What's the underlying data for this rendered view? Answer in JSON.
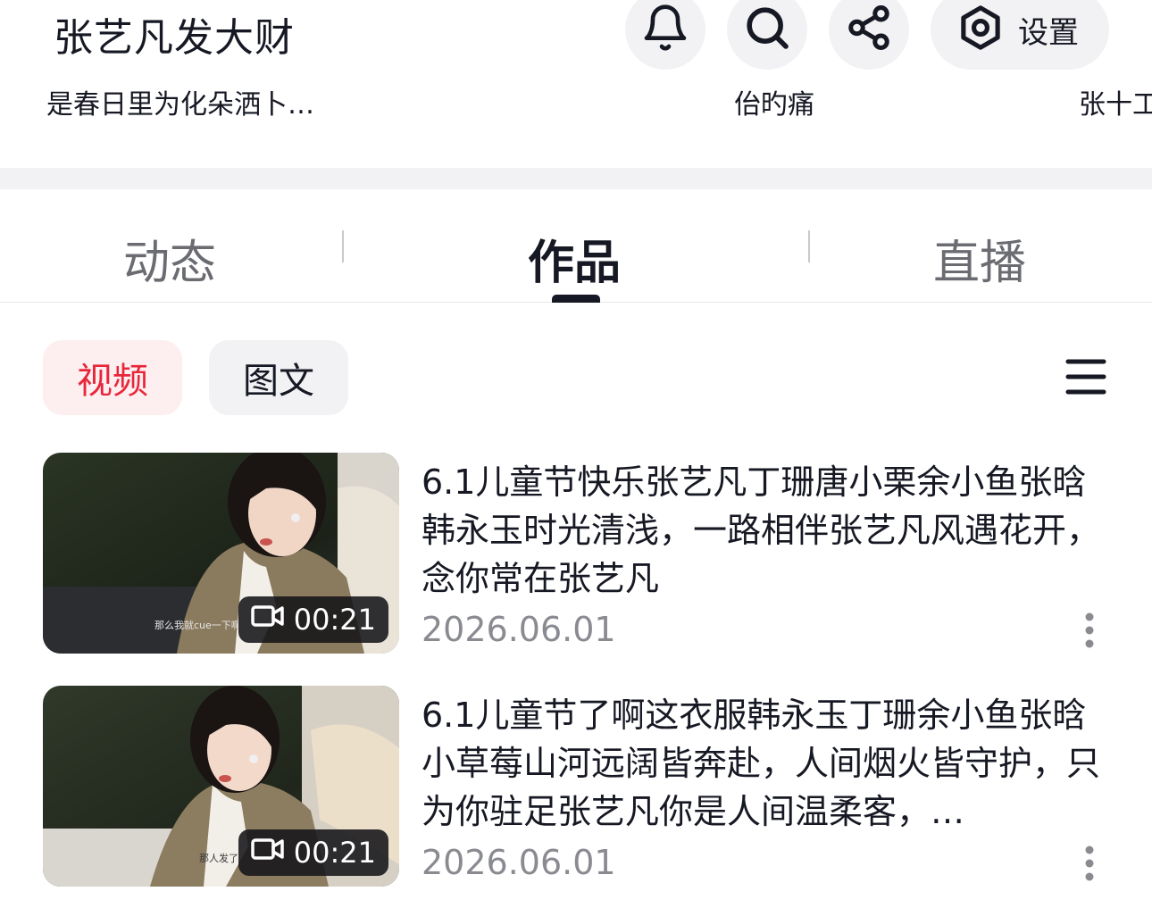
{
  "header": {
    "profile_name": "张艺凡发大财",
    "settings_label": "设置",
    "info_items": [
      "是春日里为化朵洒卜…",
      "佁旳痛",
      "张十工"
    ]
  },
  "tabs": {
    "items": [
      "动态",
      "作品",
      "直播"
    ],
    "active": "作品"
  },
  "filters": {
    "items": [
      "视频",
      "图文"
    ],
    "active": "视频"
  },
  "videos": [
    {
      "title": "6.1儿童节快乐张艺凡丁珊唐小栗余小鱼张晗韩永玉时光清浅，一路相伴张艺凡风遇花开，念你常在张艺凡",
      "date": "2026.06.01",
      "duration": "00:21",
      "subtitle": "那么我就cue一下啊"
    },
    {
      "title": "6.1儿童节了啊这衣服韩永玉丁珊余小鱼张晗小草莓山河远阔皆奔赴，人间烟火皆守护，只为你驻足张艺凡你是人间温柔客，…",
      "date": "2026.06.01",
      "duration": "00:21",
      "subtitle": "那人发了"
    }
  ],
  "colors": {
    "accent": "#e8263a",
    "text_primary": "#161823",
    "text_secondary": "#8a8b91",
    "chip_bg": "#f2f2f4"
  },
  "icons": [
    "bell-icon",
    "search-icon",
    "share-icon",
    "settings-icon",
    "sort-menu-icon",
    "video-camera-icon",
    "more-vertical-icon"
  ]
}
